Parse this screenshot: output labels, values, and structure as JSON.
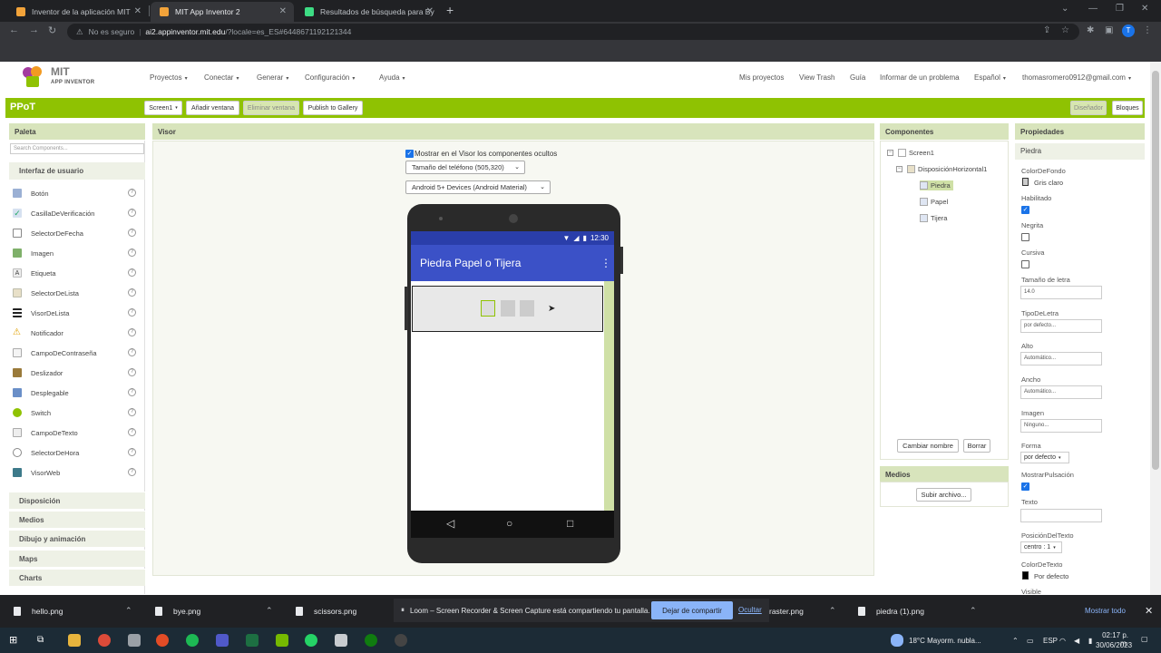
{
  "browser": {
    "tabs": [
      {
        "label": "Inventor de la aplicación MIT",
        "active": false
      },
      {
        "label": "MIT App Inventor 2",
        "active": true
      },
      {
        "label": "Resultados de búsqueda para By",
        "active": false
      }
    ],
    "security": "No es seguro",
    "host": "ai2.appinventor.mit.edu",
    "path": "/?locale=es_ES#6448671192121344",
    "profile_initial": "T"
  },
  "app": {
    "logo_title": "MIT",
    "logo_subtitle": "APP INVENTOR",
    "menu": [
      "Proyectos",
      "Conectar",
      "Generar",
      "Configuración",
      "Ayuda"
    ],
    "right_menu": [
      "Mis proyectos",
      "View Trash",
      "Guía",
      "Informar de un problema",
      "Español",
      "thomasromero0912@gmail.com"
    ],
    "project_name": "PPoT",
    "screen_select": "Screen1",
    "add_screen": "Añadir ventana",
    "remove_screen": "Eliminar ventana",
    "publish": "Publish to Gallery",
    "designer": "Diseñador",
    "blocks": "Bloques"
  },
  "palette": {
    "title": "Paleta",
    "search_placeholder": "Search Components...",
    "category_open": "Interfaz de usuario",
    "items": [
      "Botón",
      "CasillaDeVerificación",
      "SelectorDeFecha",
      "Imagen",
      "Etiqueta",
      "SelectorDeLista",
      "VisorDeLista",
      "Notificador",
      "CampoDeContraseña",
      "Deslizador",
      "Desplegable",
      "Switch",
      "CampoDeTexto",
      "SelectorDeHora",
      "VisorWeb"
    ],
    "help_glyph": "?",
    "categories": [
      "Disposición",
      "Medios",
      "Dibujo y animación",
      "Maps",
      "Charts"
    ]
  },
  "viewer": {
    "title": "Visor",
    "show_hidden_label": "Mostrar en el Visor los componentes ocultos",
    "phone_size": "Tamaño del teléfono (505,320)",
    "device_theme": "Android 5+ Devices (Android Material)",
    "status_time": "12:30",
    "app_title": "Piedra Papel o Tijera"
  },
  "components": {
    "title": "Componentes",
    "tree": [
      "Screen1",
      "DisposiciónHorizontal1",
      "Piedra",
      "Papel",
      "Tijera"
    ],
    "selected": "Piedra",
    "rename": "Cambiar nombre",
    "delete": "Borrar"
  },
  "media": {
    "title": "Medios",
    "upload": "Subir archivo..."
  },
  "properties": {
    "title": "Propiedades",
    "component": "Piedra",
    "bg_color_label": "ColorDeFondo",
    "bg_color_value": "Gris claro",
    "enabled_label": "Habilitado",
    "bold_label": "Negrita",
    "italic_label": "Cursiva",
    "font_size_label": "Tamaño de letra",
    "font_size_value": "14.0",
    "font_type_label": "TipoDeLetra",
    "font_type_value": "por defecto...",
    "height_label": "Alto",
    "height_value": "Automático...",
    "width_label": "Ancho",
    "width_value": "Automático...",
    "image_label": "Imagen",
    "image_value": "Ninguno...",
    "shape_label": "Forma",
    "shape_value": "por defecto",
    "feedback_label": "MostrarPulsación",
    "text_label": "Texto",
    "text_align_label": "PosiciónDelTexto",
    "text_align_value": "centro : 1",
    "text_color_label": "ColorDeTexto",
    "text_color_value": "Por defecto",
    "visible_label": "Visible"
  },
  "downloads": {
    "files": [
      "hello.png",
      "bye.png",
      "scissors.png",
      "raster.png",
      "piedra (1).png"
    ],
    "loom_message": "Loom – Screen Recorder & Screen Capture está compartiendo tu pantalla.",
    "stop_sharing": "Dejar de compartir",
    "hide": "Ocultar",
    "show_all": "Mostrar todo"
  },
  "taskbar": {
    "weather": "18°C  Mayorm. nubla...",
    "lang": "ESP",
    "time": "02:17 p. m.",
    "date": "30/06/2023"
  }
}
